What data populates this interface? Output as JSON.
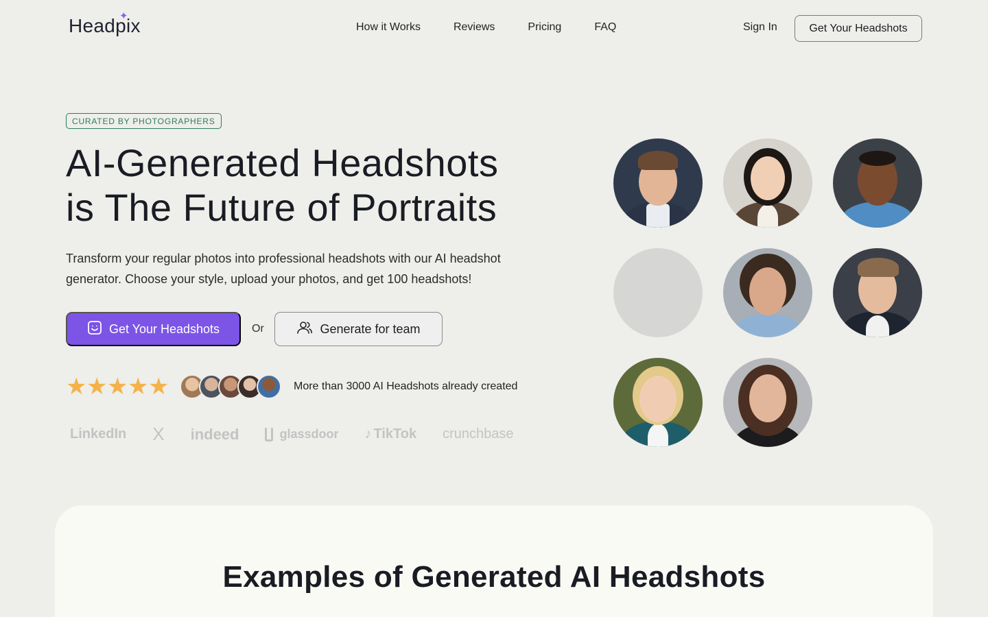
{
  "nav": {
    "logo": "Headpix",
    "links": [
      "How it Works",
      "Reviews",
      "Pricing",
      "FAQ"
    ],
    "sign_in": "Sign In",
    "cta": "Get Your Headshots"
  },
  "hero": {
    "badge": "CURATED BY PHOTOGRAPHERS",
    "title_line1": "AI-Generated Headshots",
    "title_line2": "is The Future of Portraits",
    "subtitle": "Transform your regular photos into professional headshots with our AI headshot generator. Choose your style, upload your photos, and get 100 headshots!",
    "primary_cta": "Get Your Headshots",
    "or": "Or",
    "secondary_cta": "Generate for team",
    "rating_stars": 5,
    "social_proof": "More than 3000 AI Headshots already created",
    "brands": [
      "LinkedIn",
      "X",
      "indeed",
      "glassdoor",
      "TikTok",
      "crunchbase"
    ]
  },
  "examples": {
    "title": "Examples of Generated AI Headshots"
  },
  "colors": {
    "accent": "#7c54e6",
    "badge": "#2d7a64",
    "star": "#f5b24a",
    "background": "#eeeeea"
  }
}
